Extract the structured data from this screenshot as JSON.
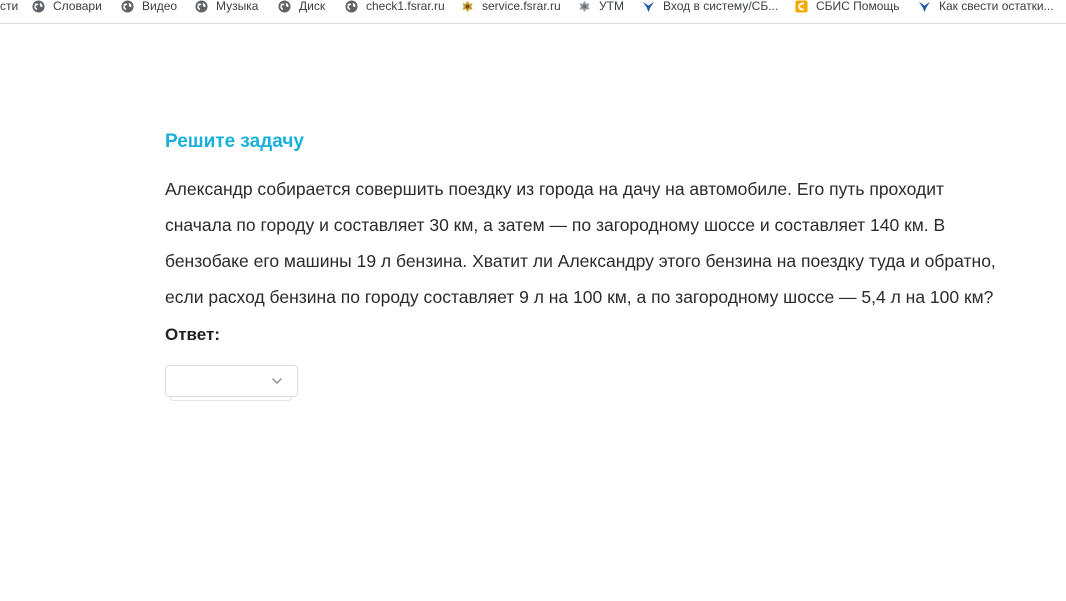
{
  "bookmarks": [
    {
      "label": "сти",
      "icon": "none"
    },
    {
      "label": "Словари",
      "icon": "globe-icon"
    },
    {
      "label": "Видео",
      "icon": "globe-icon"
    },
    {
      "label": "Музыка",
      "icon": "globe-icon"
    },
    {
      "label": "Диск",
      "icon": "globe-icon"
    },
    {
      "label": "check1.fsrar.ru",
      "icon": "globe-icon"
    },
    {
      "label": "service.fsrar.ru",
      "icon": "emblem-icon"
    },
    {
      "label": "УТМ",
      "icon": "emblem-icon"
    },
    {
      "label": "Вход в систему/СБ...",
      "icon": "bird-icon"
    },
    {
      "label": "СБИС Помощь",
      "icon": "sbis-icon"
    },
    {
      "label": "Как свести остатки...",
      "icon": "bird-icon"
    }
  ],
  "task": {
    "title": "Решите задачу",
    "text": "Александр собирается совершить поездку из города на дачу на автомобиле. Его путь проходит сначала по городу и составляет 30 км, а затем — по загородному шоссе и составляет 140 км. В бензобаке его машины 19 л бензина. Хватит ли Александру этого бензина на поездку туда и обратно, если расход бензина по городу составляет 9 л на 100 км, а по загородному шоссе — 5,4 л на 100 км?",
    "answer_label": "Ответ:",
    "answer_value": ""
  },
  "colors": {
    "title": "#1ab0dc",
    "text": "#2b2b2b",
    "border": "#dcdcdc"
  }
}
